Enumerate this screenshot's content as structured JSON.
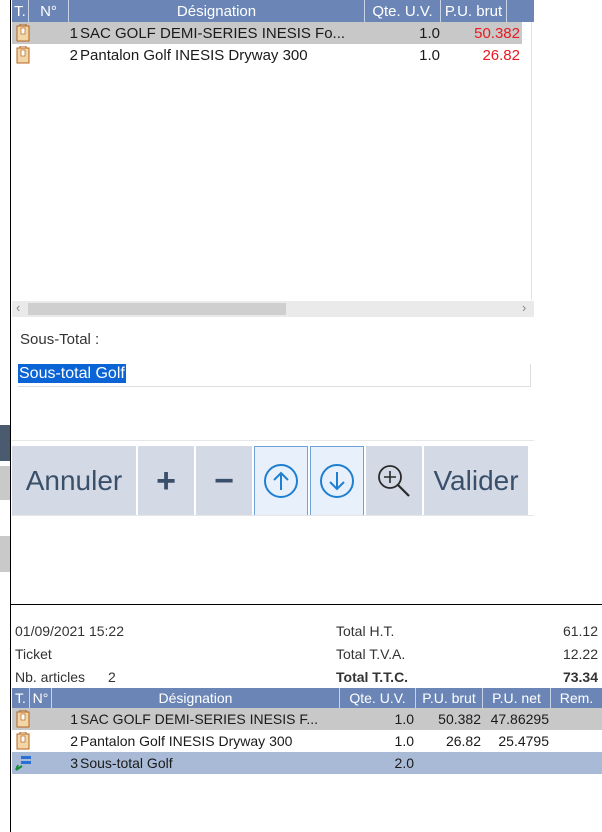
{
  "grid": {
    "headers": [
      "T.",
      "N°",
      "Désignation",
      "Qte. U.V.",
      "P.U. brut"
    ],
    "rows": [
      {
        "n": "1",
        "designation": "SAC GOLF DEMI-SERIES INESIS Fo...",
        "qte": "1.0",
        "pu": "50.382"
      },
      {
        "n": "2",
        "designation": "Pantalon Golf INESIS Dryway 300",
        "qte": "1.0",
        "pu": "26.82"
      }
    ],
    "scroll_left": "‹",
    "scroll_right": "›"
  },
  "subtotal": {
    "label": "Sous-Total :",
    "value": "Sous-total Golf"
  },
  "buttons": {
    "cancel": "Annuler",
    "plus": "+",
    "minus": "−",
    "validate": "Valider"
  },
  "ticket": {
    "datetime": "01/09/2021 15:22",
    "type": "Ticket",
    "nb_articles_label": "Nb. articles",
    "nb_articles": "2",
    "total_ht_label": "Total H.T.",
    "total_ht": "61.12",
    "total_tva_label": "Total T.V.A.",
    "total_tva": "12.22",
    "total_ttc_label": "Total T.T.C.",
    "total_ttc": "73.34"
  },
  "receipt": {
    "headers": [
      "T.",
      "N°",
      "Désignation",
      "Qte. U.V.",
      "P.U. brut",
      "P.U. net",
      "Rem."
    ],
    "rows": [
      {
        "n": "1",
        "designation": "SAC GOLF DEMI-SERIES INESIS F...",
        "qte": "1.0",
        "pu_brut": "50.382",
        "pu_net": "47.86295",
        "rem": ""
      },
      {
        "n": "2",
        "designation": "Pantalon Golf INESIS Dryway 300",
        "qte": "1.0",
        "pu_brut": "26.82",
        "pu_net": "25.4795",
        "rem": ""
      },
      {
        "n": "3",
        "designation": "Sous-total Golf",
        "qte": "2.0",
        "pu_brut": "",
        "pu_net": "",
        "rem": ""
      }
    ]
  }
}
